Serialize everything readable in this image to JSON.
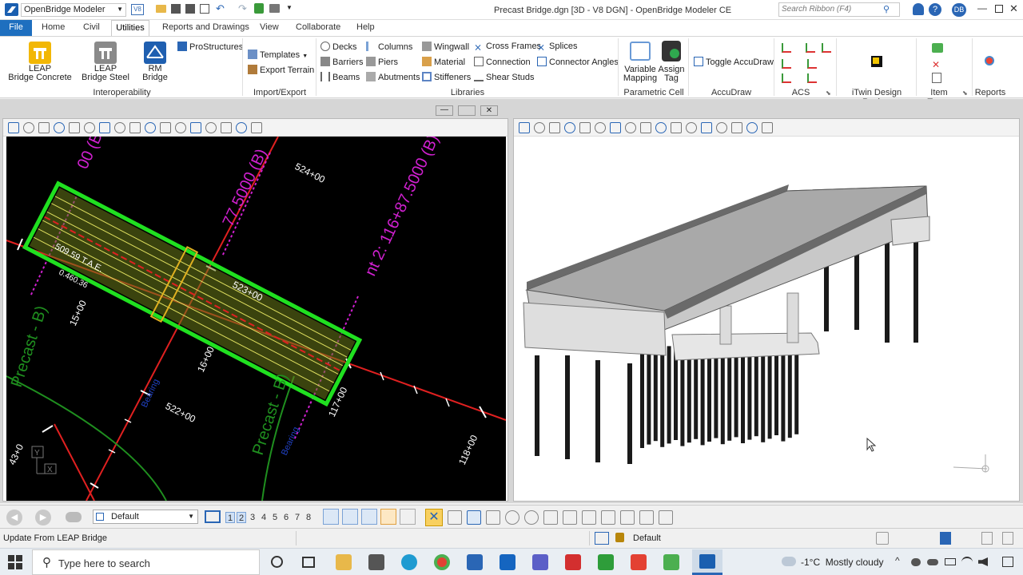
{
  "app": {
    "name": "OpenBridge Modeler",
    "window_title": "Precast Bridge.dgn [3D - V8 DGN] - OpenBridge Modeler CE",
    "search_placeholder": "Search Ribbon (F4)",
    "user_initials": "DB",
    "v8_label": "V8"
  },
  "tabs": [
    {
      "label": "File"
    },
    {
      "label": "Home"
    },
    {
      "label": "Civil"
    },
    {
      "label": "Utilities"
    },
    {
      "label": "Reports and Drawings"
    },
    {
      "label": "View"
    },
    {
      "label": "Collaborate"
    },
    {
      "label": "Help"
    }
  ],
  "ribbon": {
    "interop": {
      "group_label": "Interoperability",
      "leap_concrete": "LEAP\nBridge Concrete",
      "leap_steel": "LEAP\nBridge Steel",
      "rm_bridge": "RM\nBridge",
      "prostructures": "ProStructures"
    },
    "import_export": {
      "group_label": "Import/Export",
      "templates": "Templates",
      "export_terrain": "Export Terrain"
    },
    "libraries": {
      "group_label": "Libraries",
      "decks": "Decks",
      "barriers": "Barriers",
      "beams": "Beams",
      "columns": "Columns",
      "piers": "Piers",
      "abutments": "Abutments",
      "wingwall": "Wingwall",
      "material": "Material",
      "stiffeners": "Stiffeners",
      "cross_frames": "Cross Frames",
      "connection": "Connection",
      "shear_studs": "Shear Studs",
      "splices": "Splices",
      "connector_angles": "Connector Angles"
    },
    "parametric": {
      "group_label": "Parametric Cell",
      "variable_mapping": "Variable\nMapping",
      "assign_tag": "Assign\nTag"
    },
    "accudraw": {
      "group_label": "AccuDraw",
      "toggle": "Toggle AccuDraw"
    },
    "acs": {
      "group_label": "ACS"
    },
    "itwin": {
      "group_label": "iTwin Design Review"
    },
    "item_types": {
      "group_label": "Item Types"
    },
    "reports": {
      "group_label": "Reports"
    }
  },
  "plan_view": {
    "station_labels": [
      "524+00",
      "523+00",
      "522+00",
      "117+00",
      "118+00",
      "16+00",
      "15+00",
      "43+0"
    ],
    "magenta_labels": [
      "00 (B)",
      "77.5000 (B)",
      "nt 2: 116+87.5000 (B)"
    ],
    "green_labels": [
      "Precast - B)",
      "Precast - B)"
    ],
    "blue_labels": [
      "Bearing",
      "Bearing"
    ],
    "deck_labels": [
      "509.59 T.A.E.",
      "0.460.36"
    ],
    "colors": {
      "background": "#000000",
      "deck_outline": "#20e020",
      "deck_lines": "#e0e060",
      "alignment": "#e02020",
      "station_text": "#ffffff",
      "magenta_text": "#d020d0",
      "green_text": "#1f8f1f",
      "blue_text": "#2040c0"
    }
  },
  "bottom_toolbar": {
    "level_value": "Default",
    "view_numbers": [
      "1",
      "2",
      "3",
      "4",
      "5",
      "6",
      "7",
      "8"
    ]
  },
  "status": {
    "message": "Update From LEAP Bridge",
    "level": "Default"
  },
  "taskbar": {
    "search_placeholder": "Type here to search",
    "weather": "-1°C  Mostly cloudy"
  }
}
